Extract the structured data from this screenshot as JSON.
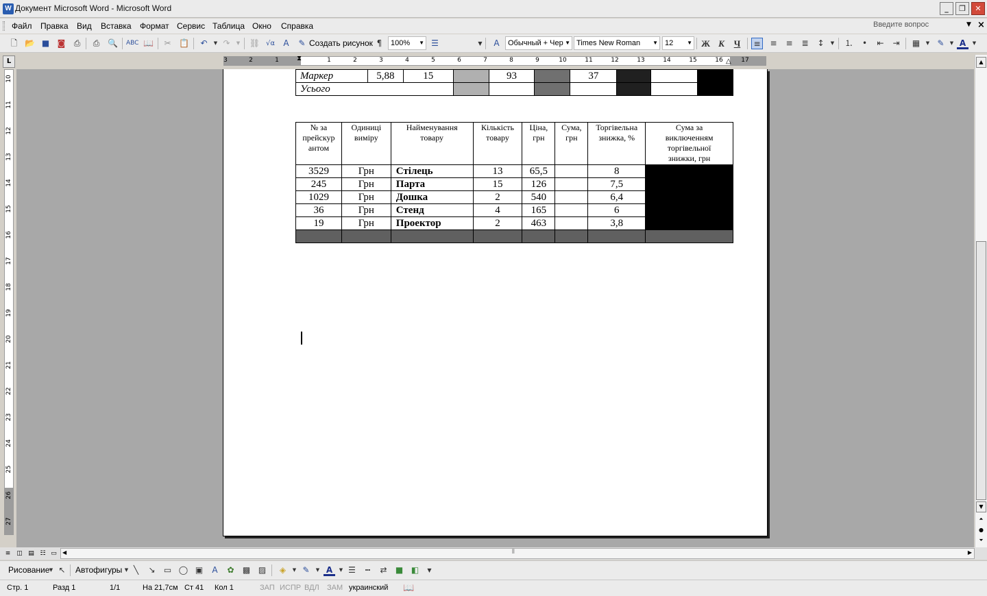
{
  "window": {
    "title": "Документ Microsoft Word - Microsoft Word",
    "app_icon": "W",
    "min_glyph": "_",
    "max_glyph": "❐",
    "close_glyph": "✕"
  },
  "menu": {
    "items": [
      "Файл",
      "Правка",
      "Вид",
      "Вставка",
      "Формат",
      "Сервис",
      "Таблица",
      "Окно",
      "Справка"
    ],
    "help_placeholder": "Введите вопрос",
    "doc_close": "×"
  },
  "toolbar": {
    "create_drawing": "Создать рисунок",
    "zoom": "100%",
    "style": "Обычный + Чер",
    "font": "Times New Roman",
    "size": "12",
    "bold": "Ж",
    "italic": "К",
    "underline": "Ч",
    "pilcrow": "¶"
  },
  "ruler": {
    "tab_glyph": "L",
    "h_numbers": [
      "3",
      "2",
      "1",
      "1",
      "2",
      "3",
      "4",
      "5",
      "6",
      "7",
      "8",
      "9",
      "10",
      "11",
      "12",
      "13",
      "14",
      "15",
      "16",
      "17"
    ],
    "v_numbers": [
      "10",
      "11",
      "12",
      "13",
      "14",
      "15",
      "16",
      "17",
      "18",
      "19",
      "20",
      "21",
      "22",
      "23",
      "24",
      "25",
      "26",
      "27"
    ]
  },
  "table1": {
    "rows": [
      {
        "name": "Маркер",
        "c2": "5,88",
        "c3": "15",
        "c5": "93",
        "c7": "37"
      },
      {
        "name": "Усього"
      }
    ]
  },
  "table2": {
    "headers": [
      "№ за прейскурантом",
      "Одиниці виміру",
      "Найменування товару",
      "Кількість товару",
      "Ціна, грн",
      "Сума, грн",
      "Торгівельна знижка, %",
      "Сума за виключенням торгівельної знижки, грн"
    ],
    "header_lines": [
      [
        "№ за",
        "прейскур",
        "антом"
      ],
      [
        "Одиниці",
        "виміру"
      ],
      [
        "Найменування",
        "товару"
      ],
      [
        "Кількість",
        "товару"
      ],
      [
        "Ціна,",
        "грн"
      ],
      [
        "Сума,",
        "грн"
      ],
      [
        "Торгівельна",
        "знижка, %"
      ],
      [
        "Сума за",
        "виключенням",
        "торгівельної",
        "знижки, грн"
      ]
    ],
    "rows": [
      {
        "num": "3529",
        "unit": "Грн",
        "name": "Стілець",
        "qty": "13",
        "price": "65,5",
        "sum": "",
        "disc": "8"
      },
      {
        "num": "245",
        "unit": "Грн",
        "name": "Парта",
        "qty": "15",
        "price": "126",
        "sum": "",
        "disc": "7,5"
      },
      {
        "num": "1029",
        "unit": "Грн",
        "name": "Дошка",
        "qty": "2",
        "price": "540",
        "sum": "",
        "disc": "6,4"
      },
      {
        "num": "36",
        "unit": "Грн",
        "name": "Стенд",
        "qty": "4",
        "price": "165",
        "sum": "",
        "disc": "6"
      },
      {
        "num": "19",
        "unit": "Грн",
        "name": "Проектор",
        "qty": "2",
        "price": "463",
        "sum": "",
        "disc": "3,8"
      }
    ]
  },
  "drawing": {
    "draw_label": "Рисование",
    "autoshapes_label": "Автофигуры"
  },
  "status": {
    "page": "Стр.  1",
    "section": "Разд  1",
    "pages": "1/1",
    "at": "На 21,7см",
    "line": "Ст  41",
    "col": "Кол  1",
    "rec": "ЗАП",
    "trk": "ИСПР",
    "ext": "ВДЛ",
    "ovr": "ЗАМ",
    "lang": "украинский"
  },
  "colors": {
    "shade_light": "#b0b0b0",
    "shade_mid": "#707070",
    "shade_dark": "#202020",
    "black": "#000000",
    "total_row": "#606060"
  }
}
